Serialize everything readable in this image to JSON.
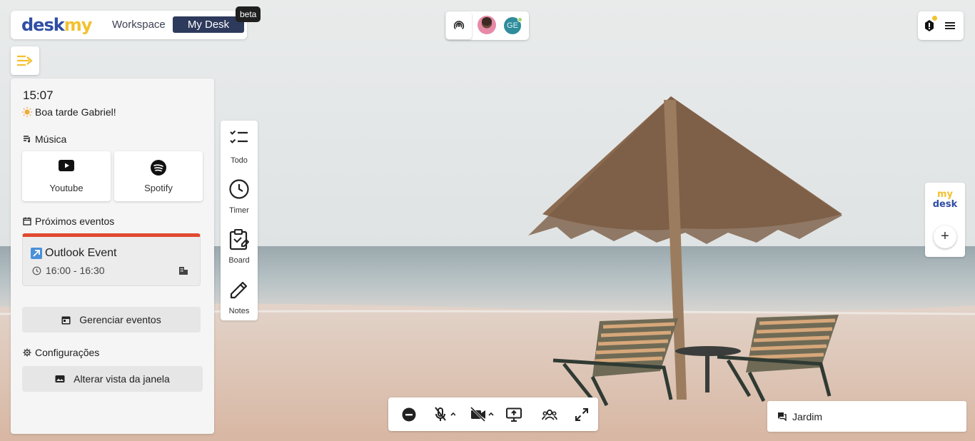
{
  "header": {
    "logo_text_a": "desk",
    "logo_text_b": "my",
    "nav_workspace": "Workspace",
    "nav_mydesk": "My Desk",
    "beta_badge": "beta",
    "avatar_initials": "GE"
  },
  "sidebar": {
    "time": "15:07",
    "greeting": "Boa tarde Gabriel!",
    "music_title": "Música",
    "music_services": [
      {
        "label": "Youtube",
        "icon": "youtube-icon"
      },
      {
        "label": "Spotify",
        "icon": "spotify-icon"
      }
    ],
    "events_title": "Próximos eventos",
    "event": {
      "title": "Outlook Event",
      "time": "16:00 - 16:30",
      "accent": "#e0492f"
    },
    "manage_events": "Gerenciar eventos",
    "settings_title": "Configurações",
    "change_view": "Alterar vista da janela"
  },
  "tools": [
    {
      "label": "Todo",
      "icon": "checklist-icon"
    },
    {
      "label": "Timer",
      "icon": "clock-icon"
    },
    {
      "label": "Board",
      "icon": "clipboard-icon"
    },
    {
      "label": "Notes",
      "icon": "pencil-icon"
    }
  ],
  "right_widget": {
    "mini_logo_a": "my",
    "mini_logo_b": "desk",
    "add_label": "+"
  },
  "room": {
    "name": "Jardim"
  },
  "colors": {
    "brand_blue": "#2f4ea3",
    "brand_yellow": "#f2c12e",
    "nav_active": "#2e3a5c"
  }
}
